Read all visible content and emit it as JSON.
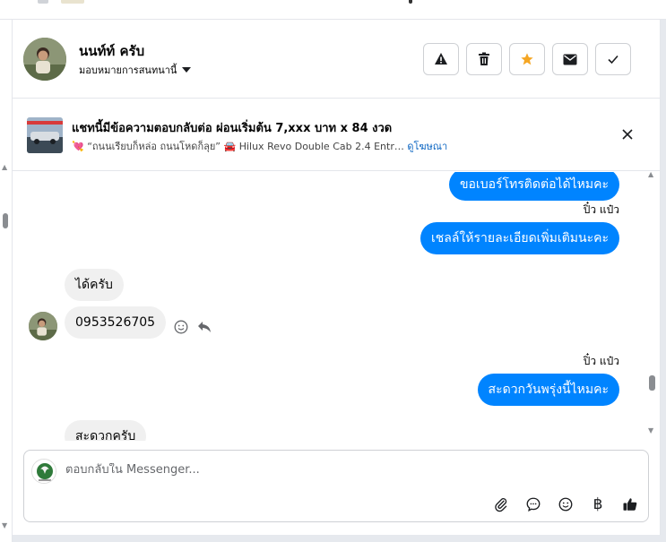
{
  "header": {
    "name": "นนท์ท์ ครับ",
    "assign_label": "มอบหมายการสนทนานี้"
  },
  "ad": {
    "title": "แชทนี้มีข้อความตอบกลับต่อ ผ่อนเริ่มต้น 7,xxx บาท x 84 งวด",
    "heart_glyph": "💘",
    "subtitle": "“ถนนเรียบก็หล่อ ถนนโหดก็ลุย”",
    "car_glyph": "🚘",
    "model": "Hilux Revo Double Cab 2.4 Entr…",
    "link": "ดูโฆษณา"
  },
  "messages": {
    "out1": "ขอเบอร์โทรติดต่อได้ไหมคะ",
    "sender1": "ปิ๋ว แป๋ว",
    "out2": "เชลล์ให้รายละเอียดเพิ่มเติมนะคะ",
    "in1": "ได้ครับ",
    "in2": "0953526705",
    "sender2": "ปิ๋ว แป๋ว",
    "out3": "สะดวกวันพรุ่งนี้ไหมคะ",
    "in3": "สะดวกครับ"
  },
  "composer": {
    "placeholder": "ตอบกลับใน Messenger...",
    "baht_glyph": "฿"
  },
  "colors": {
    "accent": "#0084ff",
    "star": "#f5a623"
  },
  "icons": [
    "warning-icon",
    "trash-icon",
    "star-icon",
    "envelope-icon",
    "check-icon",
    "close-icon",
    "emoji-icon",
    "reply-icon",
    "paperclip-icon",
    "chat-bubble-icon",
    "baht-icon",
    "thumbs-up-icon"
  ]
}
